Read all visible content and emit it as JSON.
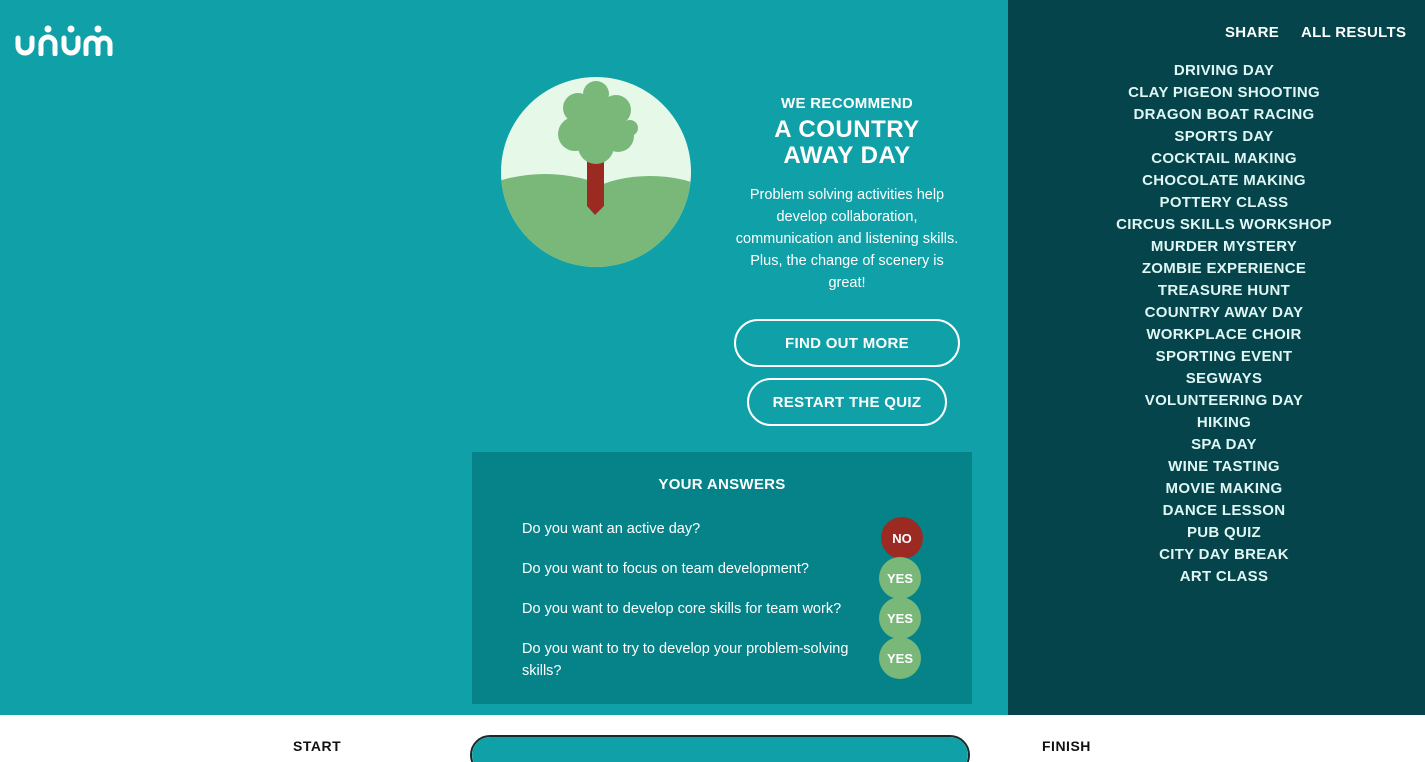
{
  "brand": {
    "logo_text": "unum",
    "color": "#ffffff"
  },
  "colors": {
    "main_bg": "#0fa0a8",
    "sidebar_bg": "#04444a",
    "answers_bg": "#058389",
    "no": "#9b2a22",
    "yes": "#7ab87a"
  },
  "header": {
    "share": "SHARE",
    "all_results": "ALL RESULTS"
  },
  "recommend": {
    "label": "WE RECOMMEND",
    "title_line1": "A COUNTRY",
    "title_line2": "AWAY DAY",
    "description": "Problem solving activities help develop collaboration, communication and listening skills. Plus, the change of scenery is great!",
    "illustration_icon": "tree-on-hill-icon"
  },
  "buttons": {
    "find_out_more": "FIND OUT MORE",
    "restart": "RESTART THE QUIZ"
  },
  "answers": {
    "title": "YOUR ANSWERS",
    "items": [
      {
        "question": "Do you want an active day?",
        "answer": "NO"
      },
      {
        "question": "Do you want to focus on team development?",
        "answer": "YES"
      },
      {
        "question": "Do you want to develop core skills for team work?",
        "answer": "YES"
      },
      {
        "question": "Do you want to try to develop your problem-solving skills?",
        "answer": "YES"
      }
    ]
  },
  "results": [
    "DRIVING DAY",
    "CLAY PIGEON SHOOTING",
    "DRAGON BOAT RACING",
    "SPORTS DAY",
    "COCKTAIL MAKING",
    "CHOCOLATE MAKING",
    "POTTERY CLASS",
    "CIRCUS SKILLS WORKSHOP",
    "MURDER MYSTERY",
    "ZOMBIE EXPERIENCE",
    "TREASURE HUNT",
    "COUNTRY AWAY DAY",
    "WORKPLACE CHOIR",
    "SPORTING EVENT",
    "SEGWAYS",
    "VOLUNTEERING DAY",
    "HIKING",
    "SPA DAY",
    "WINE TASTING",
    "MOVIE MAKING",
    "DANCE LESSON",
    "PUB QUIZ",
    "CITY DAY BREAK",
    "ART CLASS"
  ],
  "footer": {
    "start": "START",
    "finish": "FINISH",
    "progress": 1.0
  }
}
